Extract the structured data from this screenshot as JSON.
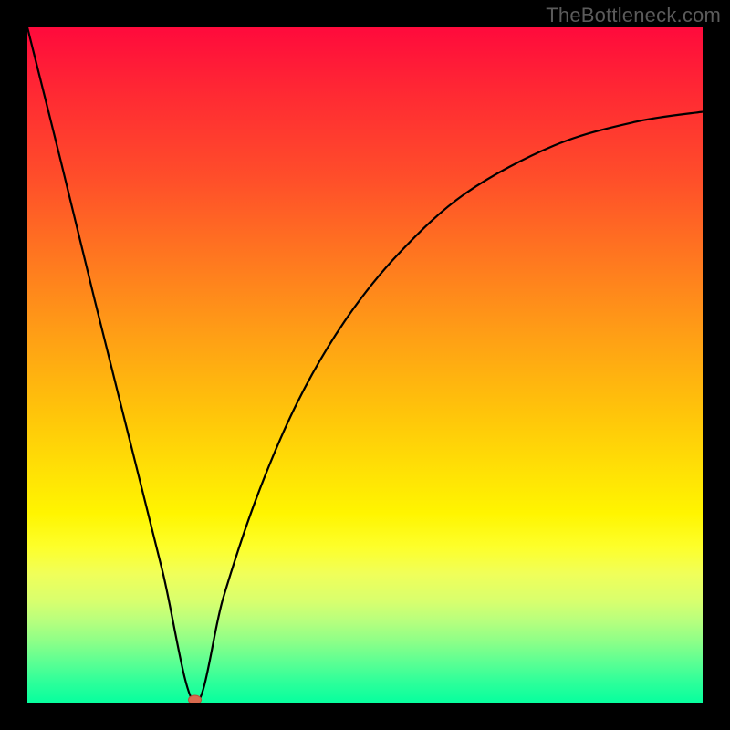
{
  "watermark": "TheBottleneck.com",
  "colors": {
    "frame": "#000000",
    "curve": "#000000",
    "marker_fill": "#d86a4e",
    "marker_stroke": "#b84f3a",
    "gradient_top": "#ff0a3c",
    "gradient_bottom": "#07ff9e"
  },
  "chart_data": {
    "type": "line",
    "x": [
      0.0,
      0.05,
      0.1,
      0.15,
      0.2,
      0.248,
      0.29,
      0.34,
      0.4,
      0.47,
      0.55,
      0.65,
      0.78,
      0.9,
      1.0
    ],
    "y": [
      1.0,
      0.8,
      0.595,
      0.395,
      0.195,
      0.0,
      0.155,
      0.305,
      0.445,
      0.565,
      0.665,
      0.755,
      0.825,
      0.86,
      0.875
    ],
    "title": "",
    "xlabel": "",
    "ylabel": "",
    "xlim": [
      0,
      1
    ],
    "ylim": [
      0,
      1
    ],
    "minimum": {
      "x": 0.248,
      "y": 0.0
    },
    "marker": {
      "x": 0.248,
      "y": 0.0,
      "shape": "ellipse"
    }
  }
}
